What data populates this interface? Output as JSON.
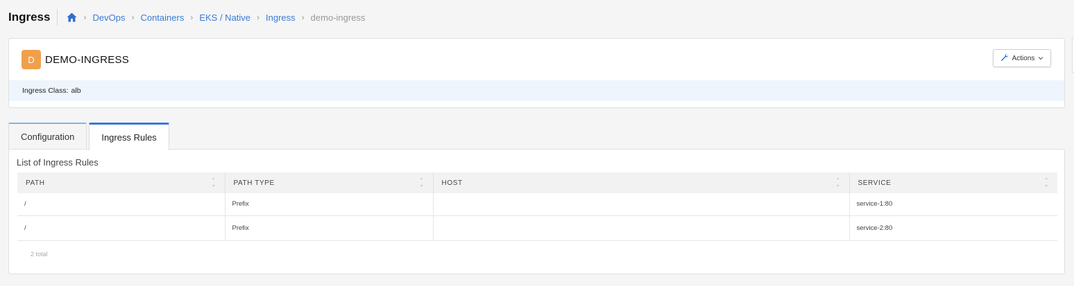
{
  "header": {
    "title": "Ingress",
    "breadcrumb": {
      "home_icon": "home-icon",
      "separator": "›",
      "items": [
        "DevOps",
        "Containers",
        "EKS / Native",
        "Ingress"
      ],
      "current": "demo-ingress"
    }
  },
  "resource": {
    "avatar_letter": "D",
    "avatar_color": "#f0a04b",
    "name": "DEMO-INGRESS",
    "actions_label": "Actions",
    "actions_icon": "wrench-icon",
    "ingress_class_label": "Ingress Class:",
    "ingress_class_value": "alb"
  },
  "tabs": [
    {
      "label": "Configuration",
      "active": false
    },
    {
      "label": "Ingress Rules",
      "active": true
    }
  ],
  "rules": {
    "title": "List of Ingress Rules",
    "columns": [
      "PATH",
      "PATH TYPE",
      "HOST",
      "SERVICE"
    ],
    "rows": [
      {
        "path": "/",
        "path_type": "Prefix",
        "host": "",
        "service": "service-1:80"
      },
      {
        "path": "/",
        "path_type": "Prefix",
        "host": "",
        "service": "service-2:80"
      }
    ],
    "total": "2 total"
  },
  "colors": {
    "accent": "#3b78d8",
    "link": "#3a7bd5",
    "avatar": "#f0a04b",
    "class_bar": "#eef5fc"
  }
}
